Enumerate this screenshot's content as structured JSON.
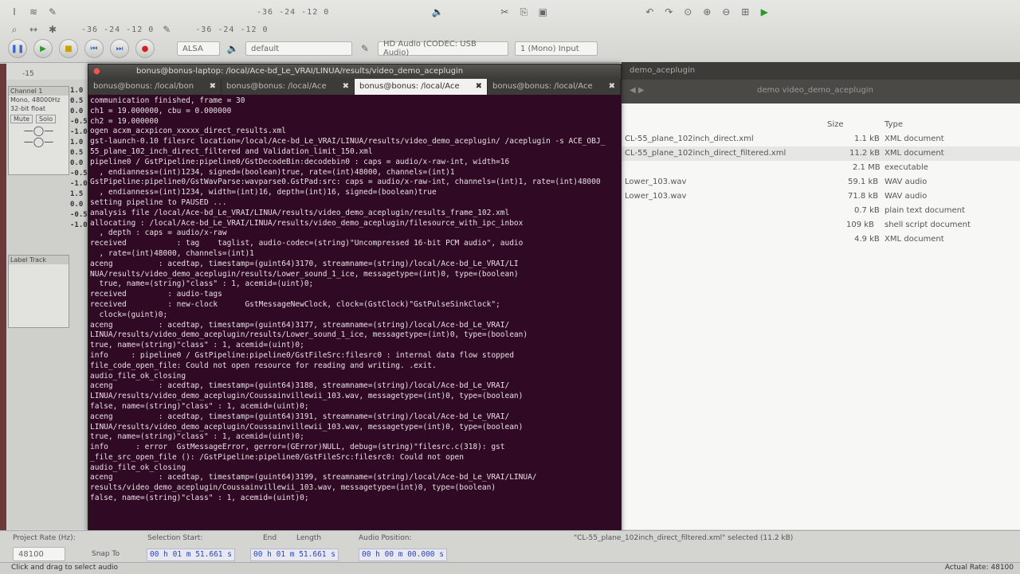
{
  "audacity": {
    "meter_scale_left": "-36 -24 -12 0",
    "meter_scale_right": "-36 -24 -12 0",
    "audio_host": "ALSA",
    "output_device": "default",
    "input_device": "HD Audio (CODEC: USB Audio)",
    "channels": "1 (Mono) Input",
    "timeline_marker": "-15",
    "track_name": "Channel 1",
    "track_rate": "Mono, 48000Hz",
    "track_format": "32-bit float",
    "track_mute": "Mute",
    "track_solo": "Solo",
    "track2_name": "Label Track",
    "scale_values": [
      "1.0",
      "0.5",
      "0.0",
      "-0.5",
      "-1.0",
      "1.0",
      "0.5",
      "0.0",
      "-0.5",
      "-1.0",
      "1.5",
      "0.0",
      "-0.5",
      "-1.0"
    ]
  },
  "terminal": {
    "title": "bonus@bonus-laptop: /local/Ace-bd_Le_VRAI/LINUA/results/video_demo_aceplugin",
    "tabs": [
      {
        "label": "bonus@bonus: /local/bon"
      },
      {
        "label": "bonus@bonus: /local/Ace"
      },
      {
        "label": "bonus@bonus: /local/Ace"
      },
      {
        "label": "bonus@bonus: /local/Ace"
      }
    ],
    "lines": [
      "communication finished, frame = 30",
      "ch1 = 19.000000, cbu = 0.000000",
      "ch2 = 19.000000",
      "ogen acxm_acxpicon_xxxxx_direct_results.xml",
      "gst-launch-0.10 filesrc location=/local/Ace-bd_Le_VRAI/LINUA/results/video_demo_aceplugin/ /aceplugin -s ACE_OBJ_",
      "55_plane_102_inch_direct_filtered and Validation_limit_150.xml",
      "pipeline0 / GstPipeline:pipeline0/GstDecodeBin:decodebin0 : caps = audio/x-raw-int, width=16",
      "  , endianness=(int)1234, signed=(boolean)true, rate=(int)48000, channels=(int)1",
      "GstPipeline:pipeline0/GstWavParse:wavparse0.GstPad:src: caps = audio/x-raw-int, channels=(int)1, rate=(int)48000",
      "  , endianness=(int)1234, width=(int)16, depth=(int)16, signed=(boolean)true",
      "setting pipeline to PAUSED ...",
      "analysis file /local/Ace-bd_Le_VRAI/LINUA/results/video_demo_aceplugin/results_frame_102.xml",
      "",
      "allocating : /local/Ace-bd_Le_VRAI/LINUA/results/video_demo_aceplugin/filesource_with_ipc_inbox",
      "  , depth : caps = audio/x-raw",
      "received           : tag    taglist, audio-codec=(string)\"Uncompressed 16-bit PCM audio\", audio",
      "  , rate=(int)48000, channels=(int)1",
      "aceng          : acedtap, timestamp=(guint64)3170, streamname=(string)/local/Ace-bd_Le_VRAI/LI",
      "NUA/results/video_demo_aceplugin/results/Lower_sound_1_ice, messagetype=(int)0, type=(boolean)",
      "  true, name=(string)\"class\" : 1, acemid=(uint)0;",
      "received         : audio-tags",
      "received         : new-clock      GstMessageNewClock, clock=(GstClock)\"GstPulseSinkClock\";",
      "  clock=(guint)0;",
      "aceng          : acedtap, timestamp=(guint64)3177, streamname=(string)/local/Ace-bd_Le_VRAI/",
      "LINUA/results/video_demo_aceplugin/results/Lower_sound_1_ice, messagetype=(int)0, type=(boolean)",
      "true, name=(string)\"class\" : 1, acemid=(uint)0;",
      "info     : pipeline0 / GstPipeline:pipeline0/GstFileSrc:filesrc0 : internal data flow stopped",
      "file_code_open_file: Could not open resource for reading and writing. .exit.",
      "audio_file_ok_closing",
      "aceng          : acedtap, timestamp=(guint64)3188, streamname=(string)/local/Ace-bd_Le_VRAI/",
      "LINUA/results/video_demo_aceplugin/Coussainvillewii_103.wav, messagetype=(int)0, type=(boolean)",
      "false, name=(string)\"class\" : 1, acemid=(uint)0;",
      "aceng          : acedtap, timestamp=(guint64)3191, streamname=(string)/local/Ace-bd_Le_VRAI/",
      "LINUA/results/video_demo_aceplugin/Coussainvillewii_103.wav, messagetype=(int)0, type=(boolean)",
      "true, name=(string)\"class\" : 1, acemid=(uint)0;",
      "info      : error  GstMessageError, gerror=(GError)NULL, debug=(string)\"filesrc.c(318): gst",
      "_file_src_open_file (): /GstPipeline:pipeline0/GstFileSrc:filesrc0: Could not open",
      "audio_file_ok_closing",
      "aceng          : acedtap, timestamp=(guint64)3199, streamname=(string)/local/Ace-bd_Le_VRAI/LINUA/",
      "results/video_demo_aceplugin/Coussainvillewii_103.wav, messagetype=(int)0, type=(boolean)",
      "false, name=(string)\"class\" : 1, acemid=(uint)0;"
    ]
  },
  "file_manager": {
    "title": "demo_aceplugin",
    "path": "demo   video_demo_aceplugin",
    "columns": {
      "size": "Size",
      "type": "Type"
    },
    "rows": [
      {
        "name": "CL-55_plane_102inch_direct.xml",
        "size": "1.1 kB",
        "type": "XML document"
      },
      {
        "name": "CL-55_plane_102inch_direct_filtered.xml",
        "size": "11.2 kB",
        "type": "XML document"
      },
      {
        "name": "",
        "size": "2.1 MB",
        "type": "executable"
      },
      {
        "name": "Lower_103.wav",
        "size": "59.1 kB",
        "type": "WAV audio"
      },
      {
        "name": "Lower_103.wav",
        "size": "71.8 kB",
        "type": "WAV audio"
      },
      {
        "name": "",
        "size": "0.7 kB",
        "type": "plain text document"
      },
      {
        "name": "",
        "size": "109 kB",
        "type": "shell script document"
      },
      {
        "name": "",
        "size": "4.9 kB",
        "type": "XML document"
      }
    ],
    "status": "\"CL-55_plane_102inch_direct_filtered.xml\" selected (11.2 kB)"
  },
  "selection": {
    "rate_label": "Project Rate (Hz):",
    "rate_value": "48100",
    "snap_label": "Snap To",
    "start_label": "Selection Start:",
    "end_label": "End",
    "length_label": "Length",
    "audio_pos_label": "Audio Position:",
    "start_value": "00 h 01 m 51.661 s",
    "end_value": "00 h 01 m 51.661 s",
    "pos_value": "00 h 00 m 00.000 s"
  },
  "status": {
    "left": "Click and drag to select audio",
    "right": "Actual Rate: 48100"
  }
}
